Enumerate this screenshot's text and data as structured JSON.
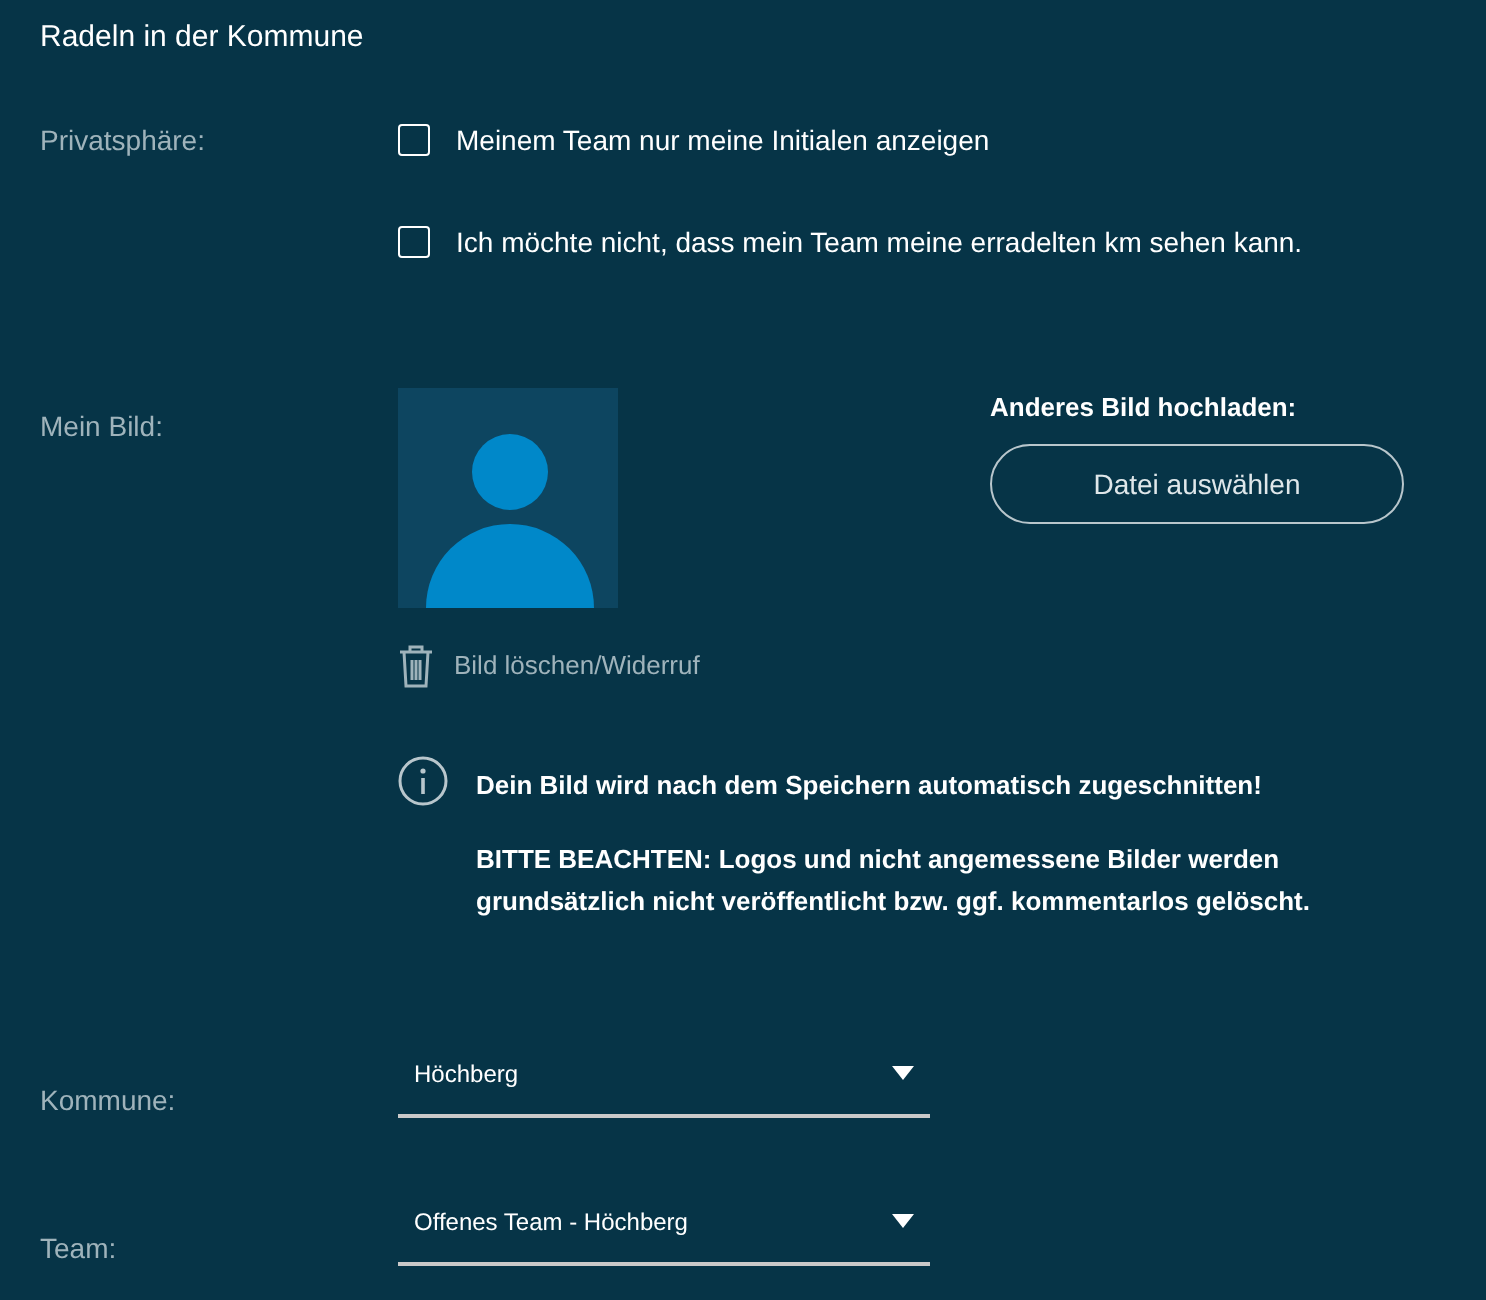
{
  "title": "Radeln in der Kommune",
  "privacy": {
    "label": "Privatsphäre:",
    "options": [
      {
        "label": "Meinem Team nur meine Initialen anzeigen",
        "checked": false
      },
      {
        "label": "Ich möchte nicht, dass mein Team meine erradelten km sehen kann.",
        "checked": false
      }
    ]
  },
  "picture": {
    "label": "Mein Bild:",
    "upload_label": "Anderes Bild hochladen:",
    "upload_button": "Datei auswählen",
    "delete_link": "Bild löschen/Widerruf",
    "notice": "Dein Bild wird nach dem Speichern automatisch zugeschnitten!",
    "warning": "BITTE BEACHTEN: Logos und nicht angemessene Bilder werden grundsätzlich nicht veröffentlicht bzw. ggf. kommentarlos gelöscht."
  },
  "selects": [
    {
      "label": "Kommune:",
      "value": "Höchberg"
    },
    {
      "label": "Team:",
      "value": "Offenes Team - Höchberg"
    }
  ]
}
